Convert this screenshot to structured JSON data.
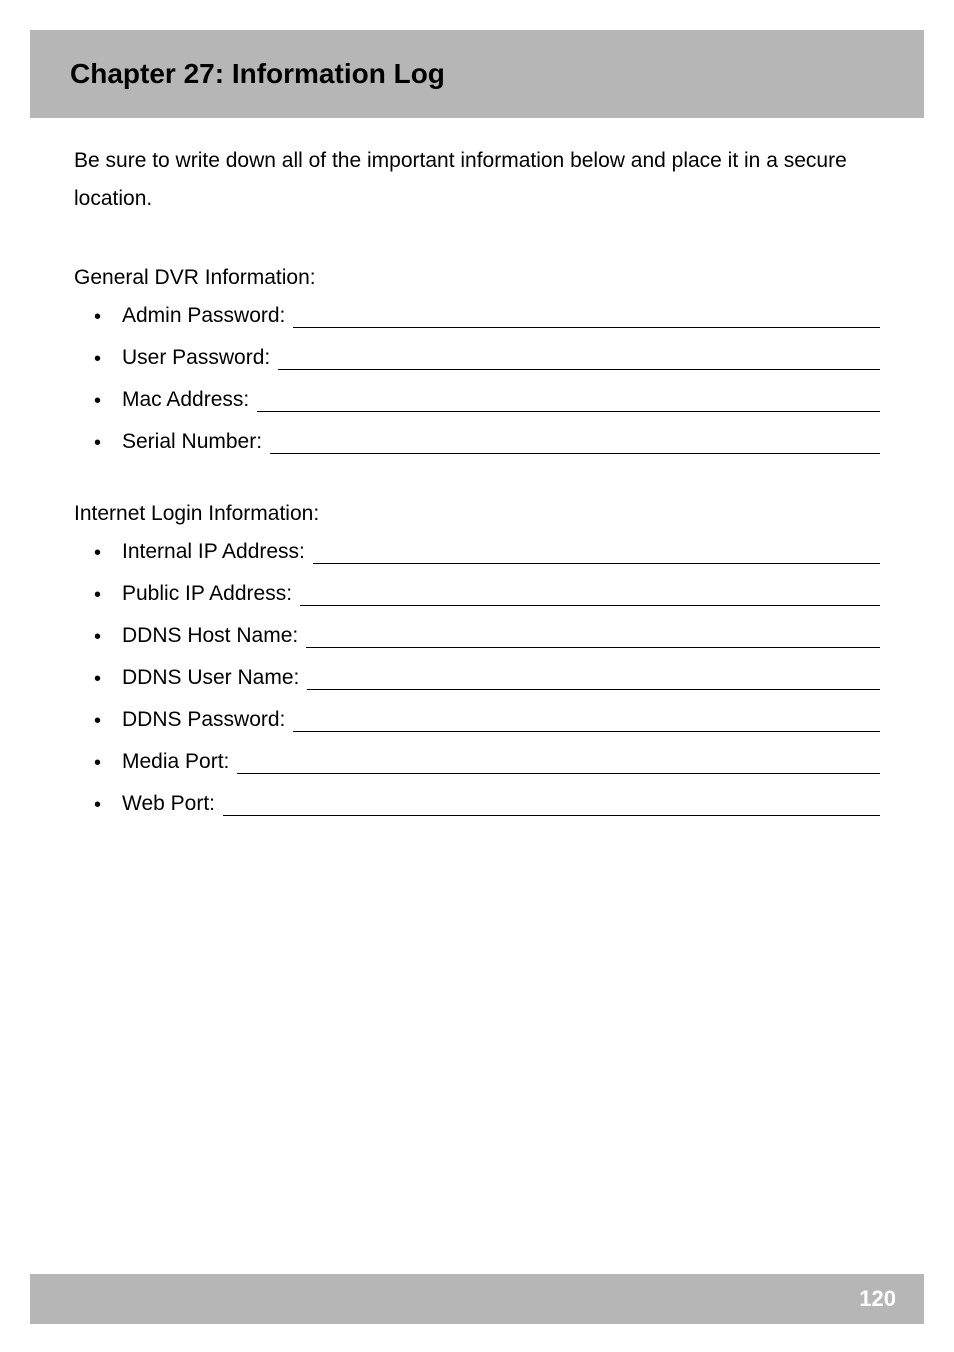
{
  "header": {
    "title": "Chapter 27: Information Log"
  },
  "intro": "Be sure to write down all of the important information below and place it in a secure location.",
  "sections": [
    {
      "title": "General DVR Information:",
      "fields": [
        "Admin Password:",
        "User Password:",
        "Mac Address:",
        "Serial Number:"
      ]
    },
    {
      "title": "Internet Login Information:",
      "fields": [
        "Internal IP Address:",
        "Public IP Address:",
        "DDNS Host Name:",
        "DDNS User Name:",
        "DDNS Password:",
        "Media Port:",
        "Web Port:"
      ]
    }
  ],
  "footer": {
    "page_number": "120"
  }
}
